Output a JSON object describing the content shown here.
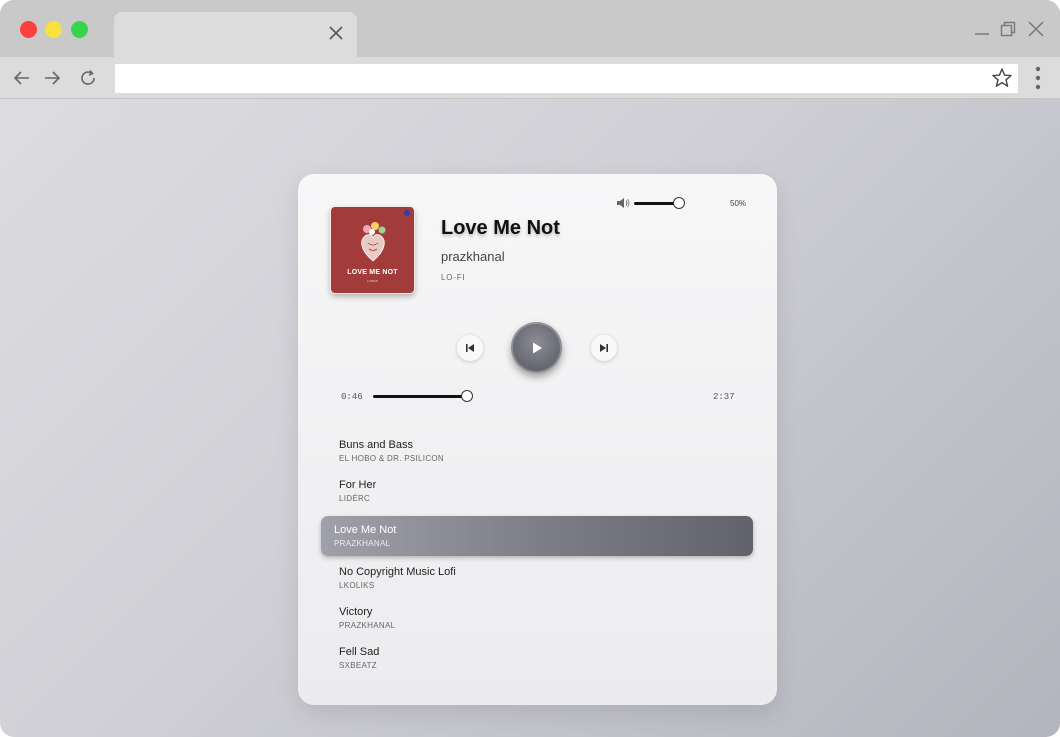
{
  "browser": {
    "address_value": "",
    "colors": {
      "close": "#fc3f3f",
      "minimize": "#f8e33c",
      "maximize": "#37d44d"
    }
  },
  "player": {
    "volume": {
      "label": "50%",
      "level": 0.5
    },
    "now_playing": {
      "title": "Love Me Not",
      "artist": "prazkhanal",
      "genre": "LO-FI",
      "cover": {
        "title": "LOVE ME NOT",
        "subtitle": "LYRICS",
        "color": "#a23c3a"
      }
    },
    "progress": {
      "current": "0:46",
      "total": "2:37",
      "fraction": 0.293
    },
    "playlist": [
      {
        "title": "Buns and Bass",
        "artist": "EL HOBO & DR. PSILICON"
      },
      {
        "title": "For Her",
        "artist": "LIDÉRC"
      },
      {
        "title": "Love Me Not",
        "artist": "PRAZKHANAL",
        "active": true
      },
      {
        "title": "No Copyright Music Lofi",
        "artist": "LKOLIKS"
      },
      {
        "title": "Victory",
        "artist": "PRAZKHANAL"
      },
      {
        "title": "Fell Sad",
        "artist": "SXBEATZ"
      }
    ]
  }
}
